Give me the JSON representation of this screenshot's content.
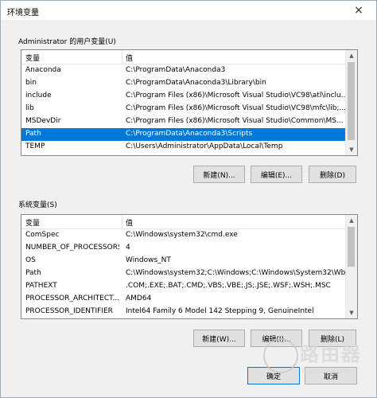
{
  "window": {
    "title": "环境变量",
    "close_glyph": "×"
  },
  "user_vars": {
    "group_label": "Administrator 的用户变量(U)",
    "columns": [
      "变量",
      "值"
    ],
    "rows": [
      {
        "name": "Anaconda",
        "value": "C:\\ProgramData\\Anaconda3"
      },
      {
        "name": "bin",
        "value": "C:\\ProgramData\\Anaconda3\\Library\\bin"
      },
      {
        "name": "include",
        "value": "C:\\Program Files (x86)\\Microsoft Visual Studio\\VC98\\atl\\inclu..."
      },
      {
        "name": "lib",
        "value": "C:\\Program Files (x86)\\Microsoft Visual Studio\\VC98\\mfc\\lib;..."
      },
      {
        "name": "MSDevDir",
        "value": "C:\\Program Files (x86)\\Microsoft Visual Studio\\Common\\MS..."
      },
      {
        "name": "Path",
        "value": "C:\\ProgramData\\Anaconda3\\Scripts",
        "selected": true
      },
      {
        "name": "TEMP",
        "value": "C:\\Users\\Administrator\\AppData\\Local\\Temp"
      }
    ],
    "buttons": {
      "new": "新建(N)...",
      "edit": "编辑(E)...",
      "delete": "删除(D)"
    }
  },
  "system_vars": {
    "group_label": "系统变量(S)",
    "columns": [
      "变量",
      "值"
    ],
    "rows": [
      {
        "name": "ComSpec",
        "value": "C:\\Windows\\system32\\cmd.exe"
      },
      {
        "name": "NUMBER_OF_PROCESSORS",
        "value": "4"
      },
      {
        "name": "OS",
        "value": "Windows_NT"
      },
      {
        "name": "Path",
        "value": "C:\\Windows\\system32;C:\\Windows;C:\\Windows\\System32\\Wb..."
      },
      {
        "name": "PATHEXT",
        "value": ".COM;.EXE;.BAT;.CMD;.VBS;.VBE;.JS;.JSE;.WSF;.WSH;.MSC"
      },
      {
        "name": "PROCESSOR_ARCHITECT...",
        "value": "AMD64"
      },
      {
        "name": "PROCESSOR_IDENTIFIER",
        "value": "Intel64 Family 6 Model 142 Stepping 9, GenuineIntel"
      }
    ],
    "buttons": {
      "new": "新建(W)...",
      "edit": "编辑(I)...",
      "delete": "删除(L)"
    }
  },
  "footer": {
    "ok": "确定",
    "cancel": "取消"
  },
  "watermark": {
    "text": "路由器",
    "sub": "luyouqi.com"
  },
  "icons": {
    "scroll_up": "▲",
    "scroll_down": "▼"
  }
}
